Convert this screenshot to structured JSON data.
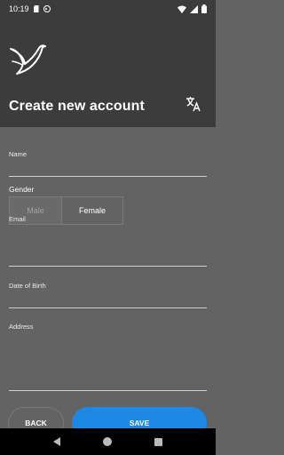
{
  "status_bar": {
    "time": "10:19"
  },
  "header": {
    "title": "Create new account"
  },
  "form": {
    "name_label": "Name",
    "gender_label": "Gender",
    "gender_options": [
      "Male",
      "Female"
    ],
    "gender_selected": "Female",
    "email_label": "Email",
    "dob_label": "Date of Birth",
    "address_label": "Address"
  },
  "buttons": {
    "back": "BACK",
    "save": "SAVE"
  },
  "colors": {
    "header_bg": "#3c3c3c",
    "body_bg": "#636363",
    "accent": "#1e88e5"
  }
}
